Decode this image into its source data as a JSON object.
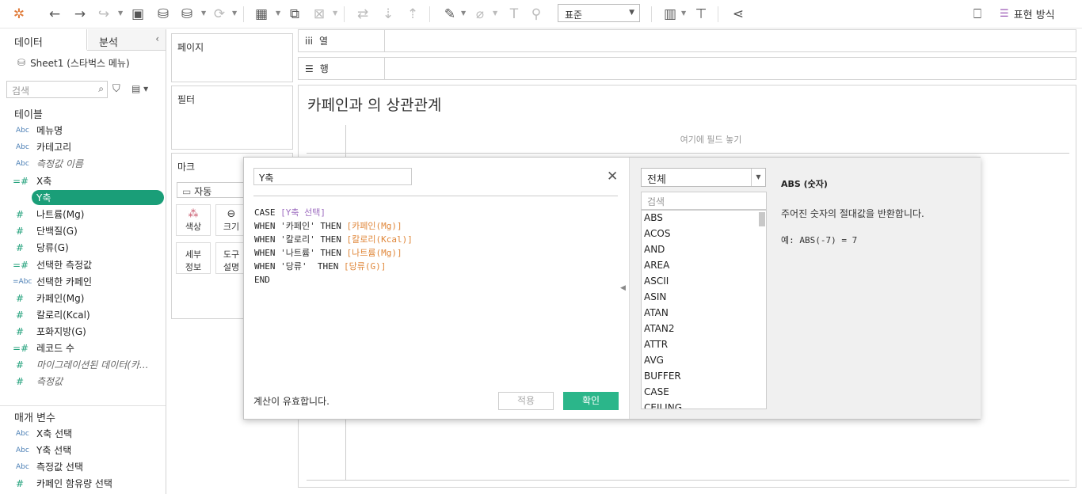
{
  "toolbar": {
    "fit_select": "표준",
    "show_me": "표현 방식"
  },
  "left_pane": {
    "tab_data": "데이터",
    "tab_analysis": "분석",
    "datasource": "Sheet1 (스타벅스 메뉴)",
    "search_placeholder": "검색",
    "tables_header": "테이블",
    "fields": [
      {
        "type": "Abc",
        "label": "메뉴명"
      },
      {
        "type": "Abc",
        "label": "카테고리"
      },
      {
        "type": "Abc",
        "label": "측정값 이름"
      },
      {
        "type": "=#",
        "label": "X축"
      },
      {
        "type": "=#",
        "label": "Y축"
      },
      {
        "type": "#",
        "label": "나트륨(Mg)"
      },
      {
        "type": "#",
        "label": "단백질(G)"
      },
      {
        "type": "#",
        "label": "당류(G)"
      },
      {
        "type": "=#",
        "label": "선택한 측정값"
      },
      {
        "type": "=Abc",
        "label": "선택한 카페인"
      },
      {
        "type": "#",
        "label": "카페인(Mg)"
      },
      {
        "type": "#",
        "label": "칼로리(Kcal)"
      },
      {
        "type": "#",
        "label": "포화지방(G)"
      },
      {
        "type": "=#",
        "label": "레코드 수"
      },
      {
        "type": "#",
        "label": "마이그레이션된 데이터(카..."
      },
      {
        "type": "#",
        "label": "측정값"
      }
    ],
    "params_header": "매개 변수",
    "params": [
      {
        "type": "Abc",
        "label": "X축 선택"
      },
      {
        "type": "Abc",
        "label": "Y축 선택"
      },
      {
        "type": "Abc",
        "label": "측정값 선택"
      },
      {
        "type": "#",
        "label": "카페인 함유량 선택"
      }
    ]
  },
  "cards": {
    "pages": "페이지",
    "filters": "필터",
    "marks": "마크",
    "mark_type": "자동",
    "color": "색상",
    "size": "크기",
    "detail_1": "세부",
    "detail_2": "정보",
    "tooltip_1": "도구",
    "tooltip_2": "설명"
  },
  "shelves": {
    "columns": "열",
    "rows": "행"
  },
  "viz": {
    "title": "카페인과 의 상관관계",
    "drop_hint": "여기에 필드 놓기"
  },
  "calc": {
    "name": "Y축",
    "code": {
      "l1_kw": "CASE ",
      "l1_param": "[Y축 선택]",
      "l2_kw": "WHEN ",
      "l2_str": "'카페인'",
      "l2_then": " THEN ",
      "l2_fld": "[카페인(Mg)]",
      "l3_str": "'칼로리'",
      "l3_fld": "[칼로리(Kcal)]",
      "l4_str": "'나트륨'",
      "l4_fld": "[나트륨(Mg)]",
      "l5_str": "'당류'",
      "l5_then": "  THEN ",
      "l5_fld": "[당류(G)]",
      "l6_kw": "END"
    },
    "status": "계산이 유효합니다.",
    "apply": "적용",
    "ok": "확인",
    "fn_category": "전체",
    "fn_search_placeholder": "검색",
    "functions": [
      "ABS",
      "ACOS",
      "AND",
      "AREA",
      "ASCII",
      "ASIN",
      "ATAN",
      "ATAN2",
      "ATTR",
      "AVG",
      "BUFFER",
      "CASE",
      "CEILING"
    ],
    "fn_title": "ABS (숫자)",
    "fn_desc": "주어진 숫자의 절대값을 반환합니다.",
    "fn_example": "예: ABS(-7) = 7"
  }
}
